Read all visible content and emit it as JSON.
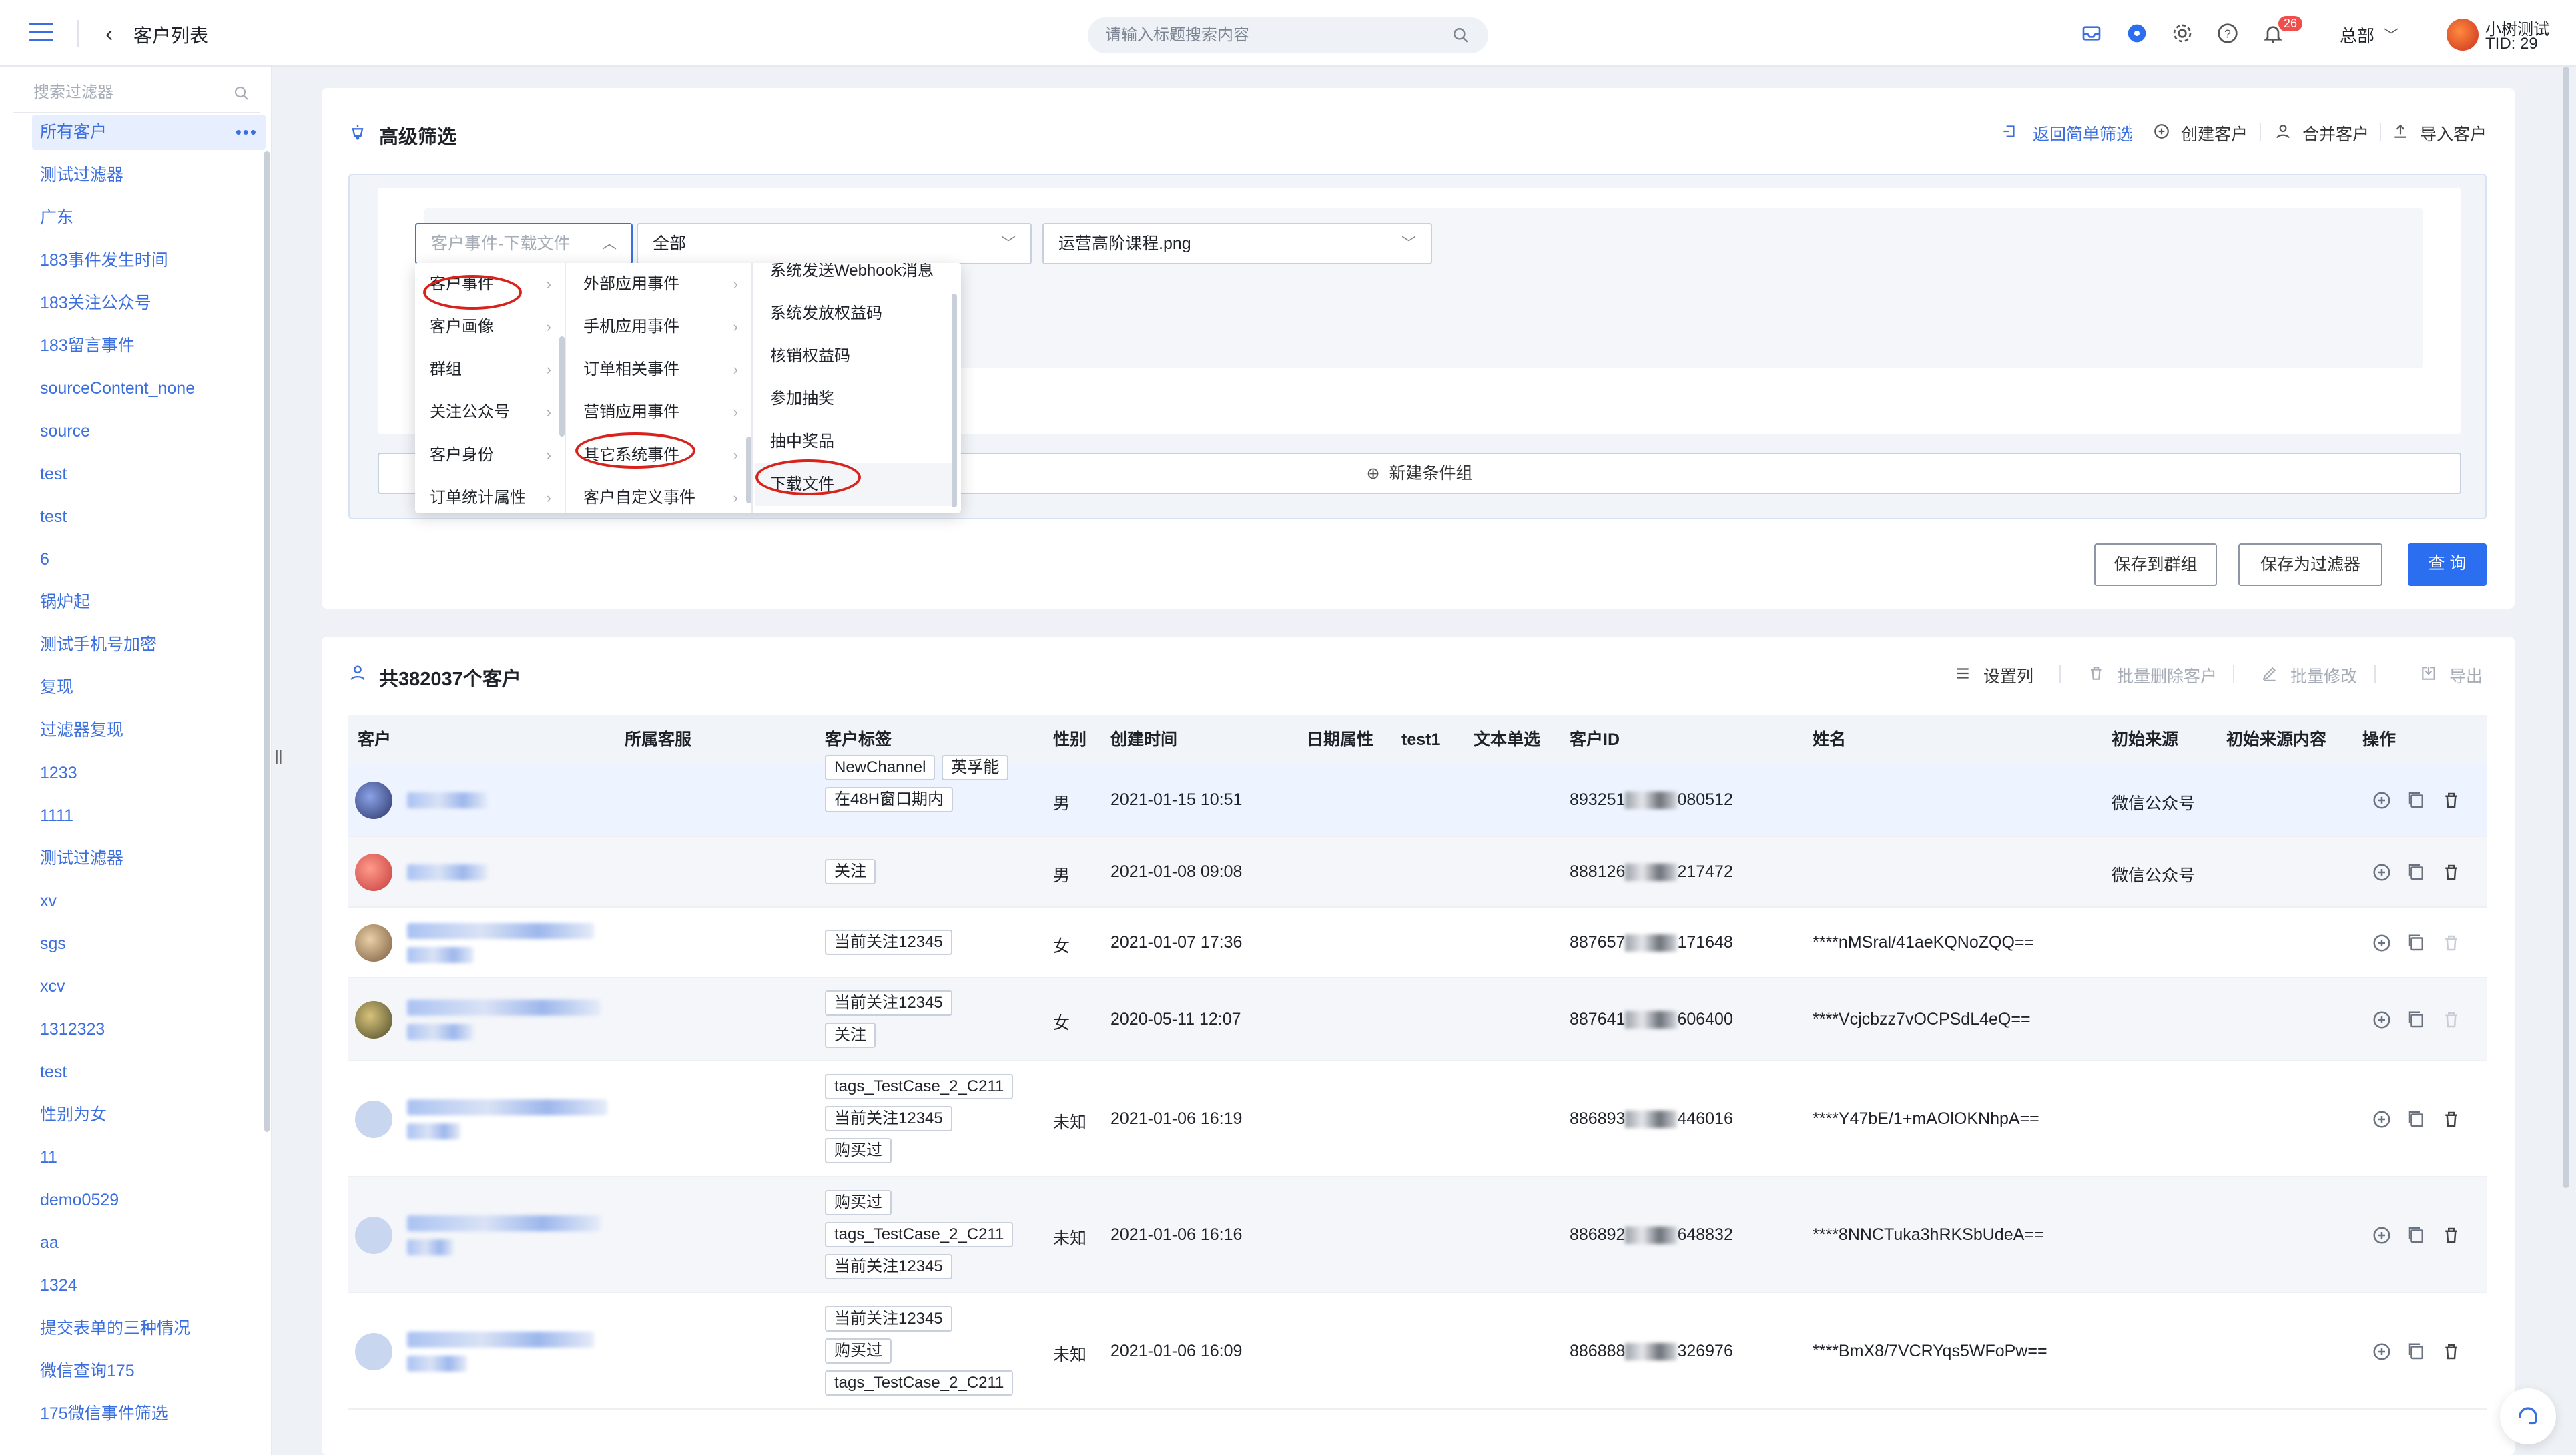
{
  "header": {
    "back_glyph": "‹",
    "title": "客户列表",
    "search_placeholder": "请输入标题搜索内容",
    "notification_count": "26",
    "tenant": "总部",
    "user_name": "小树测试",
    "user_tid": "TID: 29"
  },
  "sidebar": {
    "search_placeholder": "搜索过滤器",
    "active_dots": "•••",
    "items": [
      "所有客户",
      "测试过滤器",
      "广东",
      "183事件发生时间",
      "183关注公众号",
      "183留言事件",
      "sourceContent_none",
      "source",
      "test",
      "test",
      "6",
      "锅炉起",
      "测试手机号加密",
      "复现",
      "过滤器复现",
      "1233",
      "1111",
      "测试过滤器",
      "xv",
      "sgs",
      "xcv",
      "1312323",
      "test",
      "性别为女",
      "11",
      "demo0529",
      "aa",
      "1324",
      "提交表单的三种情况",
      "微信查询175",
      "175微信事件筛选"
    ],
    "collapse_glyph": "||"
  },
  "advanced": {
    "title": "高级筛选",
    "actions": {
      "back_simple": "返回简单筛选",
      "create": "创建客户",
      "merge": "合并客户",
      "import": "导入客户"
    },
    "select_event_placeholder": "客户事件-下载文件",
    "select_scope": "全部",
    "select_file": "运营高阶课程.png",
    "new_group": "新建条件组",
    "btn_save_group": "保存到群组",
    "btn_save_filter": "保存为过滤器",
    "btn_query": "查 询",
    "cascader": {
      "col1": [
        "客户事件",
        "客户画像",
        "群组",
        "关注公众号",
        "客户身份",
        "订单统计属性"
      ],
      "col2": [
        "外部应用事件",
        "手机应用事件",
        "订单相关事件",
        "营销应用事件",
        "其它系统事件",
        "客户自定义事件"
      ],
      "col3": [
        "系统发送Webhook消息",
        "系统发放权益码",
        "核销权益码",
        "参加抽奖",
        "抽中奖品",
        "下载文件"
      ],
      "arrow": "›"
    }
  },
  "customer_list": {
    "title": "共382037个客户",
    "actions": {
      "columns": "设置列",
      "batch_delete": "批量删除客户",
      "batch_edit": "批量修改",
      "export": "导出"
    },
    "columns": [
      "客户",
      "所属客服",
      "客户标签",
      "性别",
      "创建时间",
      "日期属性",
      "test1",
      "文本单选",
      "客户ID",
      "姓名",
      "初始来源",
      "初始来源内容",
      "操作"
    ],
    "rows": [
      {
        "tags": [
          "NewChannel",
          "英孚能",
          "在48H窗口期内"
        ],
        "gender": "男",
        "created": "2021-01-15 10:51",
        "id_prefix": "893251",
        "id_suffix": "080512",
        "name": "",
        "source": "微信公众号"
      },
      {
        "tags": [
          "关注"
        ],
        "gender": "男",
        "created": "2021-01-08 09:08",
        "id_prefix": "888126",
        "id_suffix": "217472",
        "name": "",
        "source": "微信公众号"
      },
      {
        "tags": [
          "当前关注12345"
        ],
        "gender": "女",
        "created": "2021-01-07 17:36",
        "id_prefix": "887657",
        "id_suffix": "171648",
        "name": "****nMSral/41aeKQNoZQQ==",
        "source": ""
      },
      {
        "tags": [
          "当前关注12345",
          "关注"
        ],
        "gender": "女",
        "created": "2020-05-11 12:07",
        "id_prefix": "887641",
        "id_suffix": "606400",
        "name": "****Vcjcbzz7vOCPSdL4eQ==",
        "source": ""
      },
      {
        "tags": [
          "tags_TestCase_2_C211",
          "当前关注12345",
          "购买过"
        ],
        "gender": "未知",
        "created": "2021-01-06 16:19",
        "id_prefix": "886893",
        "id_suffix": "446016",
        "name": "****Y47bE/1+mAOlOKNhpA==",
        "source": ""
      },
      {
        "tags": [
          "购买过",
          "tags_TestCase_2_C211",
          "当前关注12345"
        ],
        "gender": "未知",
        "created": "2021-01-06 16:16",
        "id_prefix": "886892",
        "id_suffix": "648832",
        "name": "****8NNCTuka3hRKSbUdeA==",
        "source": ""
      },
      {
        "tags": [
          "当前关注12345",
          "购买过",
          "tags_TestCase_2_C211"
        ],
        "gender": "未知",
        "created": "2021-01-06 16:09",
        "id_prefix": "886888",
        "id_suffix": "326976",
        "name": "****BmX8/7VCRYqs5WFoPw==",
        "source": ""
      }
    ]
  },
  "colors": {
    "accent": "#2b6ff0",
    "link": "#3b6fe0",
    "highlight_ring": "#d8231c",
    "notification": "#f04d4d"
  }
}
